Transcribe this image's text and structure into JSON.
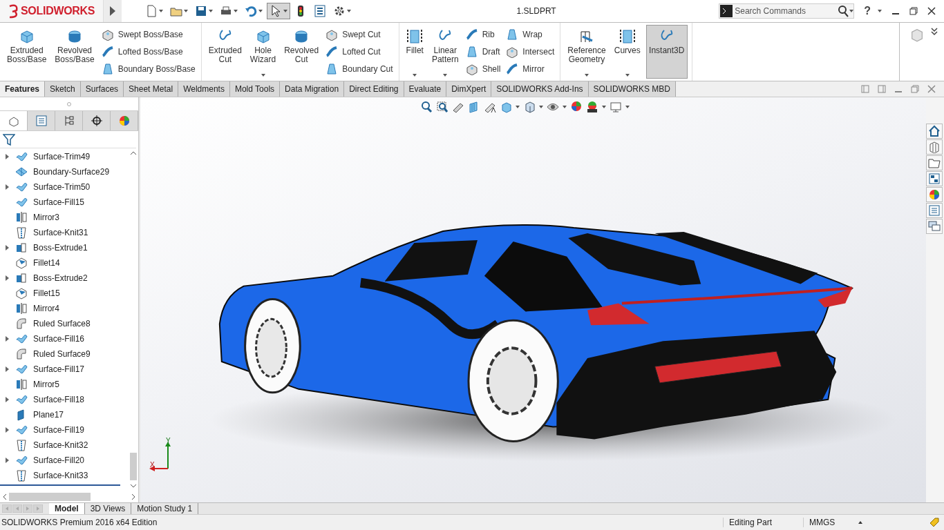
{
  "app": {
    "logo": "SOLIDWORKS",
    "title": "1.SLDPRT",
    "help": "?"
  },
  "quick_tools": [
    {
      "selected": false
    },
    {
      "selected": false
    },
    {
      "selected": false
    },
    {
      "selected": false
    },
    {
      "selected": false
    },
    {
      "selected": true
    },
    {
      "selected": false
    },
    {
      "selected": false
    },
    {
      "selected": false
    }
  ],
  "search": {
    "placeholder": "Search Commands"
  },
  "ribbon": {
    "groups": [
      {
        "items": [
          {
            "kind": "large",
            "label": "Extruded Boss/Base",
            "dropdown": false,
            "selected": false
          },
          {
            "kind": "large",
            "label": "Revolved Boss/Base",
            "dropdown": false,
            "selected": false
          },
          {
            "kind": "stack",
            "labels": [
              "Swept Boss/Base",
              "Lofted Boss/Base",
              "Boundary Boss/Base"
            ]
          }
        ]
      },
      {
        "items": [
          {
            "kind": "large",
            "label": "Extruded Cut",
            "dropdown": false,
            "selected": false
          },
          {
            "kind": "large",
            "label": "Hole Wizard",
            "dropdown": true,
            "selected": false
          },
          {
            "kind": "large",
            "label": "Revolved Cut",
            "dropdown": false,
            "selected": false
          },
          {
            "kind": "stack",
            "labels": [
              "Swept Cut",
              "Lofted Cut",
              "Boundary Cut"
            ]
          }
        ]
      },
      {
        "items": [
          {
            "kind": "large",
            "label": "Fillet",
            "dropdown": true,
            "selected": false
          },
          {
            "kind": "large",
            "label": "Linear Pattern",
            "dropdown": true,
            "selected": false
          },
          {
            "kind": "stack",
            "labels": [
              "Rib",
              "Draft",
              "Shell"
            ]
          },
          {
            "kind": "stack",
            "labels": [
              "Wrap",
              "Intersect",
              "Mirror"
            ]
          }
        ]
      },
      {
        "items": [
          {
            "kind": "large",
            "label": "Reference Geometry",
            "dropdown": true,
            "selected": false
          },
          {
            "kind": "large",
            "label": "Curves",
            "dropdown": true,
            "selected": false
          },
          {
            "kind": "large",
            "label": "Instant3D",
            "dropdown": false,
            "selected": true
          }
        ]
      }
    ]
  },
  "tabs": [
    {
      "label": "Features",
      "selected": true
    },
    {
      "label": "Sketch",
      "selected": false
    },
    {
      "label": "Surfaces",
      "selected": false
    },
    {
      "label": "Sheet Metal",
      "selected": false
    },
    {
      "label": "Weldments",
      "selected": false
    },
    {
      "label": "Mold Tools",
      "selected": false
    },
    {
      "label": "Data Migration",
      "selected": false
    },
    {
      "label": "Direct Editing",
      "selected": false
    },
    {
      "label": "Evaluate",
      "selected": false
    },
    {
      "label": "DimXpert",
      "selected": false
    },
    {
      "label": "SOLIDWORKS Add-Ins",
      "selected": false
    },
    {
      "label": "SOLIDWORKS MBD",
      "selected": false
    }
  ],
  "panel_tabs": [
    {
      "selected": true
    },
    {
      "selected": false
    },
    {
      "selected": false
    },
    {
      "selected": false
    },
    {
      "selected": false
    }
  ],
  "tree": [
    {
      "label": "Surface-Trim49",
      "kind": "surface",
      "expandable": true
    },
    {
      "label": "Boundary-Surface29",
      "kind": "boundary",
      "expandable": false
    },
    {
      "label": "Surface-Trim50",
      "kind": "surface",
      "expandable": true
    },
    {
      "label": "Surface-Fill15",
      "kind": "surface",
      "expandable": false
    },
    {
      "label": "Mirror3",
      "kind": "mirror",
      "expandable": false
    },
    {
      "label": "Surface-Knit31",
      "kind": "knit",
      "expandable": false
    },
    {
      "label": "Boss-Extrude1",
      "kind": "extrude",
      "expandable": true
    },
    {
      "label": "Fillet14",
      "kind": "fillet",
      "expandable": false
    },
    {
      "label": "Boss-Extrude2",
      "kind": "extrude",
      "expandable": true
    },
    {
      "label": "Fillet15",
      "kind": "fillet",
      "expandable": false
    },
    {
      "label": "Mirror4",
      "kind": "mirror",
      "expandable": false
    },
    {
      "label": "Ruled Surface8",
      "kind": "ruled",
      "expandable": false
    },
    {
      "label": "Surface-Fill16",
      "kind": "surface",
      "expandable": true
    },
    {
      "label": "Ruled Surface9",
      "kind": "ruled",
      "expandable": false
    },
    {
      "label": "Surface-Fill17",
      "kind": "surface",
      "expandable": true
    },
    {
      "label": "Mirror5",
      "kind": "mirror",
      "expandable": false
    },
    {
      "label": "Surface-Fill18",
      "kind": "surface",
      "expandable": true
    },
    {
      "label": "Plane17",
      "kind": "plane",
      "expandable": false
    },
    {
      "label": "Surface-Fill19",
      "kind": "surface",
      "expandable": true
    },
    {
      "label": "Surface-Knit32",
      "kind": "knit",
      "expandable": false
    },
    {
      "label": "Surface-Fill20",
      "kind": "surface",
      "expandable": true
    },
    {
      "label": "Surface-Knit33",
      "kind": "knit",
      "expandable": false
    }
  ],
  "triad": {
    "y": "Y",
    "x": "X"
  },
  "bottom_tabs": [
    {
      "label": "Model",
      "selected": true
    },
    {
      "label": "3D Views",
      "selected": false
    },
    {
      "label": "Motion Study 1",
      "selected": false
    }
  ],
  "status_bar": {
    "edition": "SOLIDWORKS Premium 2016 x64 Edition",
    "mode": "Editing Part",
    "units": "MMGS"
  }
}
